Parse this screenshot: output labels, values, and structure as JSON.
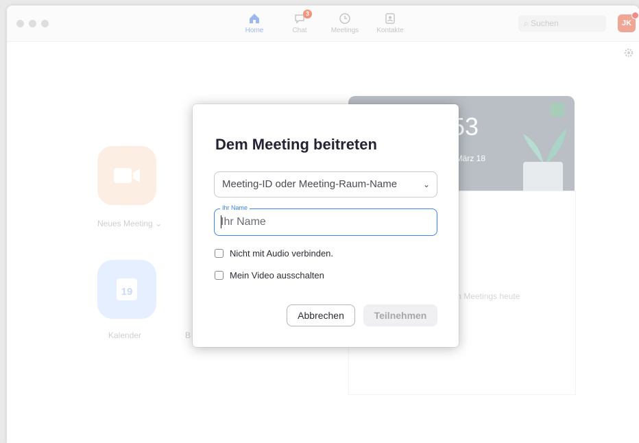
{
  "titlebar": {
    "nav": [
      {
        "label": "Home",
        "icon": "home-icon",
        "active": true
      },
      {
        "label": "Chat",
        "icon": "chat-icon",
        "badge": "3"
      },
      {
        "label": "Meetings",
        "icon": "clock-icon"
      },
      {
        "label": "Kontakte",
        "icon": "contacts-icon"
      }
    ],
    "search_placeholder": "Suchen",
    "avatar_initials": "JK"
  },
  "home": {
    "tiles": [
      {
        "label": "Neues Meeting",
        "icon": "video-camera-icon",
        "color": "#f6a76a"
      },
      {
        "label": "Kalender",
        "icon": "calendar-icon",
        "date": "19",
        "color": "#4a8ef0"
      }
    ],
    "partial_label": "B",
    "clock_time": ":53",
    "clock_date": ", März 18",
    "meetings_empty": "den Meetings heute"
  },
  "dialog": {
    "title": "Dem Meeting beitreten",
    "meeting_id_placeholder": "Meeting-ID oder Meeting-Raum-Name",
    "name_legend": "Ihr Name",
    "name_placeholder": "Ihr Name",
    "checkbox_audio": "Nicht mit Audio verbinden.",
    "checkbox_video": "Mein Video ausschalten",
    "cancel_label": "Abbrechen",
    "join_label": "Teilnehmen"
  },
  "colors": {
    "accent": "#3b82f6",
    "title": "#232333",
    "join_disabled": "#a6a6ad"
  }
}
